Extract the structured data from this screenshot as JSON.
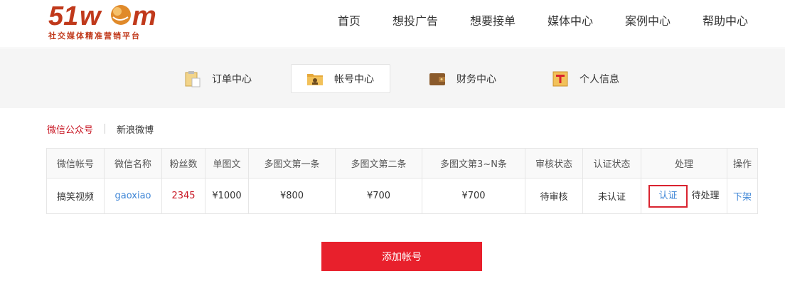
{
  "brand": {
    "logo_text": "51wom",
    "tagline": "社交媒体精准营销平台",
    "colors": {
      "primary": "#c0391b",
      "accent": "#e08a2a"
    }
  },
  "nav": {
    "items": [
      {
        "label": "首页"
      },
      {
        "label": "想投广告"
      },
      {
        "label": "想要接单"
      },
      {
        "label": "媒体中心"
      },
      {
        "label": "案例中心"
      },
      {
        "label": "帮助中心"
      }
    ]
  },
  "subnav": {
    "items": [
      {
        "label": "订单中心",
        "icon": "clipboard-icon",
        "active": false
      },
      {
        "label": "帐号中心",
        "icon": "id-card-folder-icon",
        "active": true
      },
      {
        "label": "财务中心",
        "icon": "wallet-icon",
        "active": false
      },
      {
        "label": "个人信息",
        "icon": "profile-card-icon",
        "active": false
      }
    ]
  },
  "platforms": {
    "active": "微信公众号",
    "inactive": "新浪微博"
  },
  "table": {
    "columns": [
      "微信帐号",
      "微信名称",
      "粉丝数",
      "单图文",
      "多图文第一条",
      "多图文第二条",
      "多图文第3~N条",
      "审核状态",
      "认证状态",
      "处理",
      "操作"
    ],
    "rows": [
      {
        "account": "搞笑视频",
        "name": "gaoxiao",
        "fans": "2345",
        "single": "¥1000",
        "multi_first": "¥800",
        "multi_second": "¥700",
        "multi_rest": "¥700",
        "review_status": "待审核",
        "verify_status": "未认证",
        "process_link": "认证",
        "process_status": "待处理",
        "action": "下架"
      }
    ]
  },
  "add_button": {
    "label": "添加帐号"
  },
  "colors": {
    "accent_red": "#e8202c",
    "link_blue": "#3f86d6",
    "highlight_red": "#c81623"
  }
}
